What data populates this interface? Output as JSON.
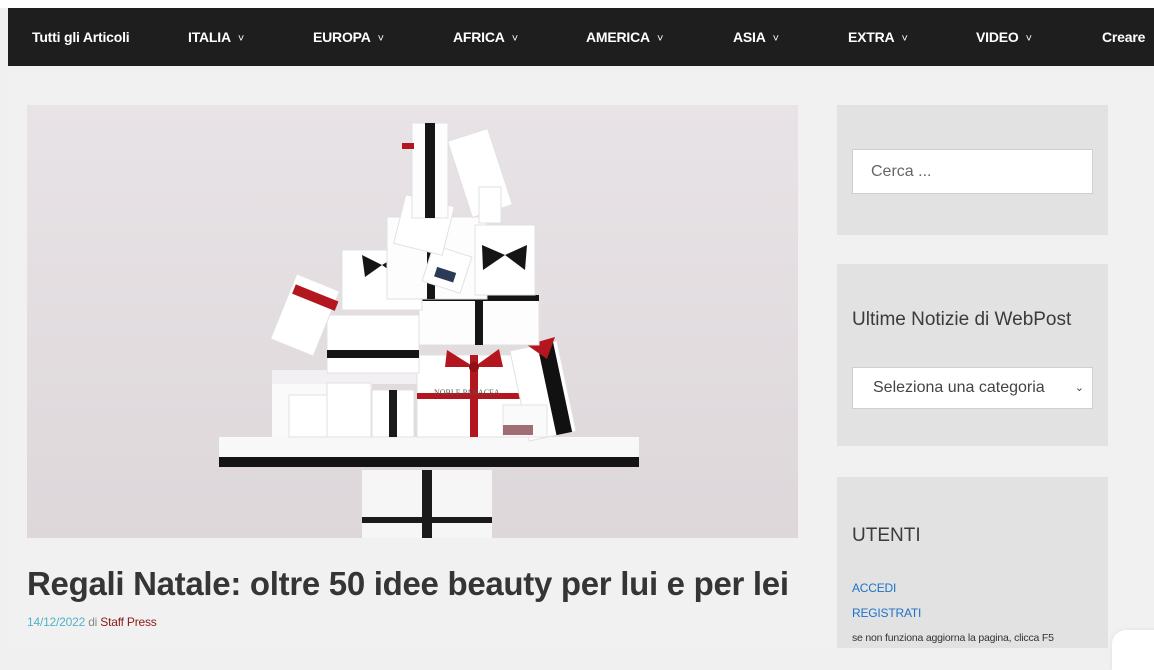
{
  "nav": {
    "items": [
      {
        "label": "Tutti gli Articoli"
      },
      {
        "label": "ITALIA",
        "chevron": "˅"
      },
      {
        "label": "EUROPA",
        "chevron": "˅"
      },
      {
        "label": "AFRICA",
        "chevron": "˅"
      },
      {
        "label": "AMERICA",
        "chevron": "˅"
      },
      {
        "label": "ASIA",
        "chevron": "˅"
      },
      {
        "label": "EXTRA",
        "chevron": "˅"
      },
      {
        "label": "VIDEO",
        "chevron": "˅"
      },
      {
        "label": "Creare"
      }
    ]
  },
  "post": {
    "title": "Regali Natale: oltre 50 idee beauty per lui e per lei",
    "date": "14/12/2022",
    "by": "di",
    "author": "Staff Press",
    "image_brand_text": "NOBLE PANACEA"
  },
  "sidebar": {
    "search_placeholder": "Cerca ...",
    "news_title": "Ultime Notizie di WebPost",
    "category_select": "Seleziona una categoria",
    "users_title": "UTENTI",
    "login_link": "ACCEDI",
    "register_link": "REGISTRATI",
    "refresh_note": "se non funziona aggiorna la pagina, clicca F5"
  },
  "colors": {
    "navbar": "#1e1e1e",
    "date": "#4fb3c9",
    "author": "#8b1a1a",
    "link": "#1d72c7",
    "ribbon_red": "#b3161e"
  }
}
